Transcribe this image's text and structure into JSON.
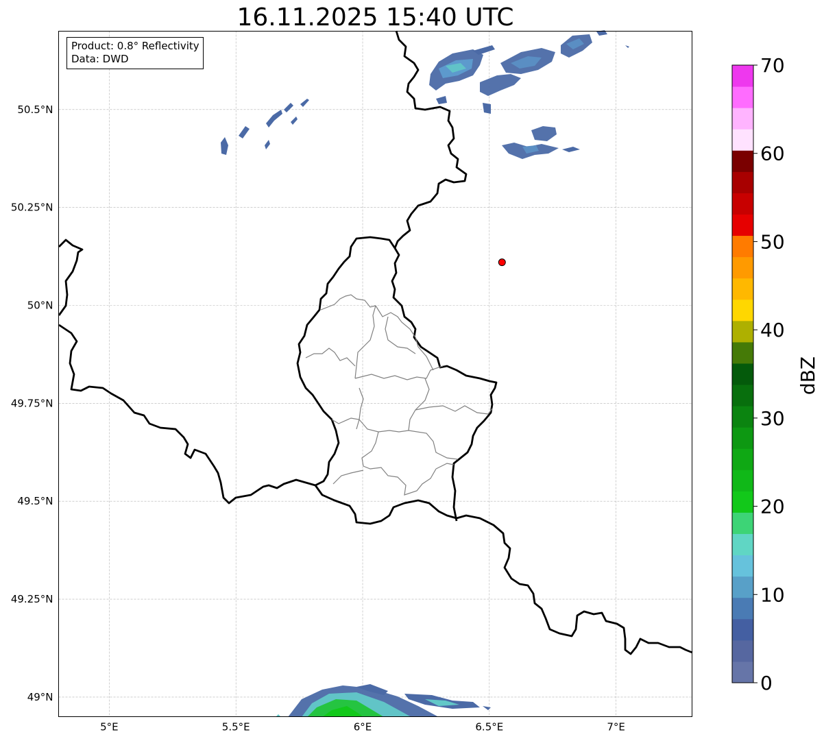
{
  "title": "16.11.2025 15:40 UTC",
  "info_box": {
    "product": "Product: 0.8° Reflectivity",
    "data": "Data: DWD"
  },
  "axes": {
    "lon_ticks": [
      "5°E",
      "5.5°E",
      "6°E",
      "6.5°E",
      "7°E"
    ],
    "lat_ticks": [
      "50.5°N",
      "50.25°N",
      "50°N",
      "49.75°N",
      "49.5°N",
      "49.25°N",
      "49°N"
    ],
    "lon_values": [
      5.0,
      5.5,
      6.0,
      6.5,
      7.0
    ],
    "lat_values": [
      50.5,
      50.25,
      50.0,
      49.75,
      49.5,
      49.25,
      49.0
    ],
    "extent": {
      "lon_min": 4.8,
      "lon_max": 7.3,
      "lat_min": 48.95,
      "lat_max": 50.7
    },
    "gridlines": true
  },
  "marker": {
    "lon": 6.55,
    "lat": 50.11,
    "color": "#ff0000"
  },
  "colorbar": {
    "label": "dBZ",
    "min": 0,
    "max": 70,
    "tick_labels": [
      "0",
      "10",
      "20",
      "30",
      "40",
      "50",
      "60",
      "70"
    ],
    "tick_values": [
      0,
      10,
      20,
      30,
      40,
      50,
      60,
      70
    ],
    "colors": [
      "#6675a8",
      "#5667a0",
      "#445fa2",
      "#4a7bb4",
      "#58a0c8",
      "#66c2dc",
      "#60d6c4",
      "#3dd476",
      "#12c81a",
      "#10b818",
      "#0fa814",
      "#0d9812",
      "#0b8410",
      "#086f0d",
      "#045a0b",
      "#457a07",
      "#aeb000",
      "#ffd700",
      "#ffb800",
      "#ff9a00",
      "#ff7b00",
      "#e60000",
      "#c80000",
      "#a80000",
      "#7a0000",
      "#ffe2ff",
      "#ffb4ff",
      "#ff6cff",
      "#ee38ee"
    ]
  },
  "colors": {
    "country_border": "#000000",
    "canton_border": "#808080",
    "grid": "#b0b0b0",
    "echo_dark": "#4b6aa6",
    "echo_mid": "#5b8fc4",
    "echo_light": "#62c8c8",
    "echo_green": "#22c43a"
  }
}
